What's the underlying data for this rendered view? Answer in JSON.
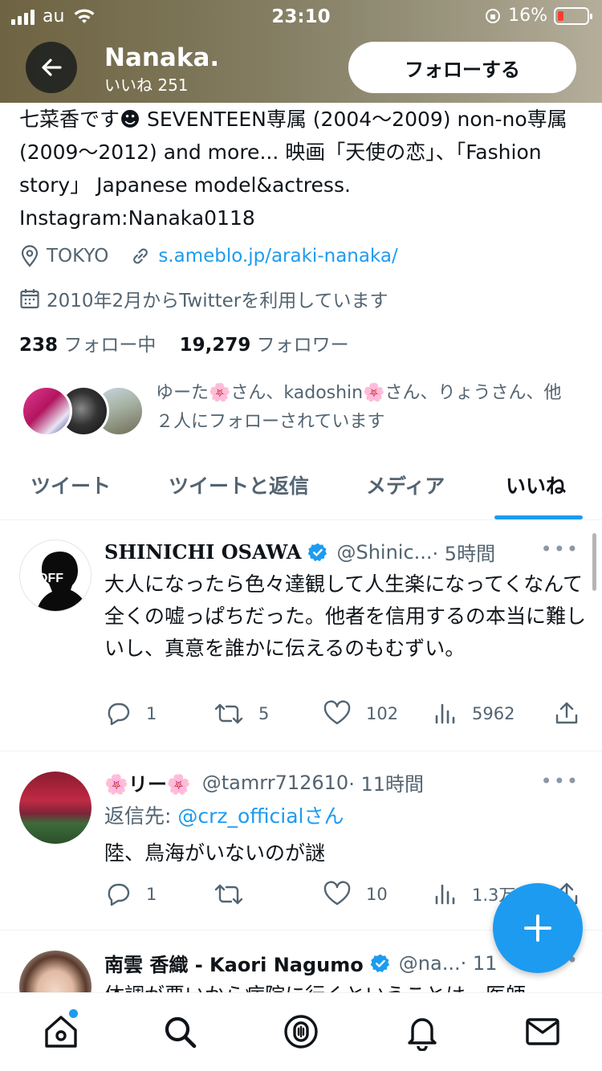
{
  "status_bar": {
    "carrier": "au",
    "time": "23:10",
    "battery": "16%"
  },
  "header": {
    "name": "Nanaka.",
    "likes": "いいね 251",
    "follow_label": "フォローする"
  },
  "profile": {
    "bio": "七菜香です☻ SEVENTEEN専属 (2004～2009) non-no専属 (2009～2012) and more... 映画「天使の恋」、「Fashion story」 Japanese model&actress. Instagram:Nanaka0118",
    "location": "TOKYO",
    "link": "s.ameblo.jp/araki-nanaka/",
    "joined": "2010年2月からTwitterを利用しています",
    "following_count": "238",
    "following_label": "フォロー中",
    "followers_count": "19,279",
    "followers_label": "フォロワー",
    "followed_by": "ゆーた🌸さん、kadoshin🌸さん、りょうさん、他２人にフォローされています"
  },
  "tabs": [
    "ツイート",
    "ツイートと返信",
    "メディア",
    "いいね"
  ],
  "active_tab": "いいね",
  "tweets": [
    {
      "name": "SHINICHI OSAWA",
      "handle": "@Shinic...",
      "time": "· 5時間",
      "avatar_text": "OFF",
      "body": "大人になったら色々達観して人生楽になってくなんて全くの嘘っぱちだった。他者を信用するの本当に難しいし、真意を誰かに伝えるのもむずい。",
      "replies": "1",
      "retweets": "5",
      "likes": "102",
      "views": "5962"
    },
    {
      "name": "🌸リー🌸",
      "handle": "@tamrr712610",
      "time": "· 11時間",
      "reply_prefix": "返信先:",
      "reply_to": "@crz_official",
      "reply_suffix": "さん",
      "body": "陸、鳥海がいないのが謎",
      "replies": "1",
      "retweets": "",
      "likes": "10",
      "views": "1.3万"
    },
    {
      "name": "南雲 香織 - Kaori Nagumo",
      "handle": "@na...",
      "time": "· 11",
      "body": "体調が悪いから病院に行くということは、医師"
    }
  ],
  "more_glyph": "•••",
  "colors": {
    "accent": "#1d9bf0",
    "text": "#0f1419",
    "secondary": "#536471"
  },
  "icons": [
    "back-arrow-icon",
    "location-icon",
    "link-icon",
    "calendar-icon",
    "verified-icon",
    "reply-icon",
    "retweet-icon",
    "like-icon",
    "views-icon",
    "share-icon",
    "compose-plus-icon",
    "home-icon",
    "search-icon",
    "spaces-icon",
    "bell-icon",
    "mail-icon"
  ]
}
